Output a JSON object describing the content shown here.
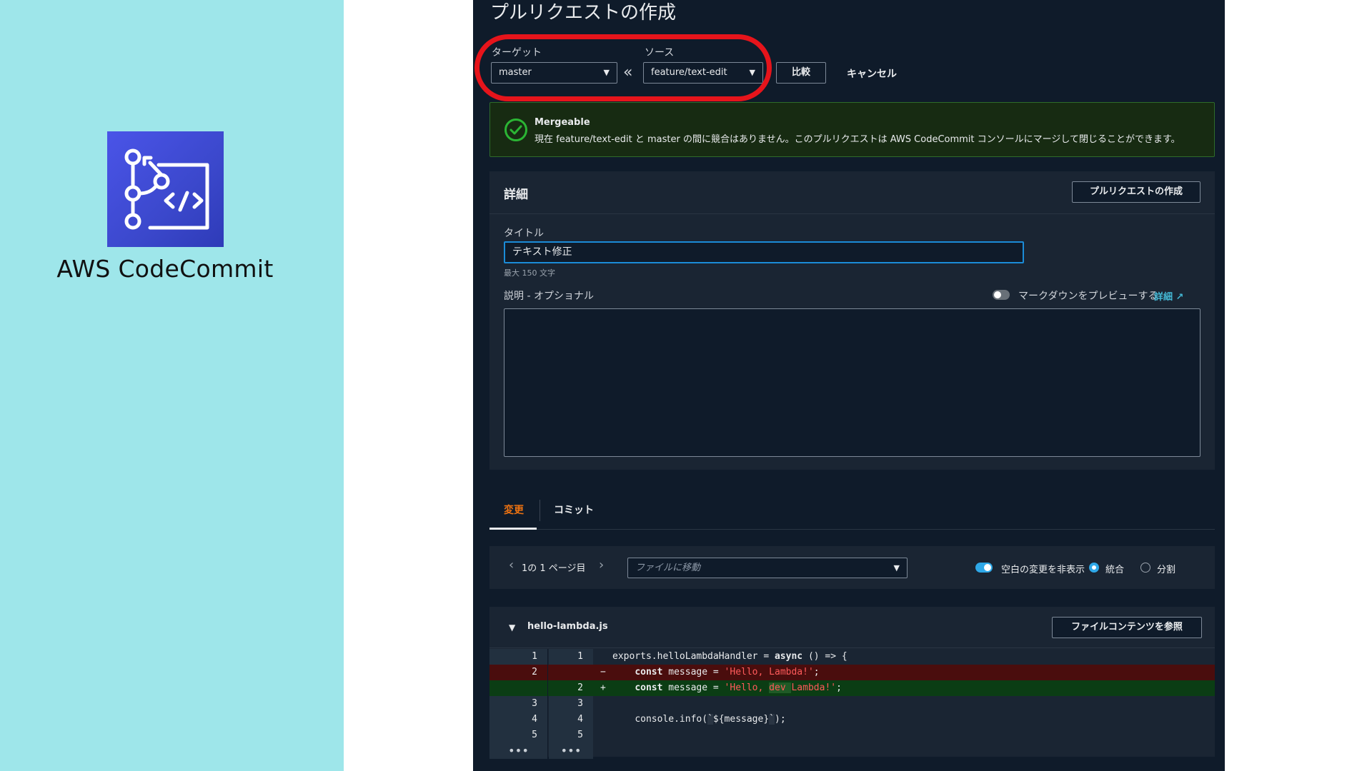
{
  "slide": {
    "product_name": "AWS CodeCommit",
    "background_color": "#9ee6ea",
    "logo_icon": "codecommit-logo-icon"
  },
  "console": {
    "page_title": "プルリクエストの作成",
    "target": {
      "label": "ターゲット",
      "value": "master"
    },
    "source": {
      "label": "ソース",
      "value": "feature/text-edit"
    },
    "compare_button": "比較",
    "cancel_button": "キャンセル",
    "alert": {
      "title": "Mergeable",
      "message": "現在 feature/text-edit と master の間に競合はありません。このプルリクエストは AWS CodeCommit コンソールにマージして閉じることができます。",
      "color": "#2bb534"
    },
    "details": {
      "title": "詳細",
      "create_button": "プルリクエストの作成",
      "title_field_label": "タイトル",
      "title_field_value": "テキスト修正",
      "title_hint": "最大 150 文字",
      "description_label": "説明 - オプショナル",
      "markdown_preview_label": "マークダウンをプレビューする",
      "markdown_preview_on": false,
      "details_link": "詳細"
    },
    "tabs": [
      {
        "label": "変更",
        "active": true
      },
      {
        "label": "コミット",
        "active": false
      }
    ],
    "diff_toolbar": {
      "pager": "1の 1 ページ目",
      "file_select_placeholder": "ファイルに移動",
      "hide_whitespace_label": "空白の変更を非表示",
      "hide_whitespace_on": true,
      "view_modes": [
        {
          "label": "統合",
          "selected": true
        },
        {
          "label": "分割",
          "selected": false
        }
      ]
    },
    "diff_file": {
      "name": "hello-lambda.js",
      "browse_button": "ファイルコンテンツを参照",
      "lines": [
        {
          "old": "1",
          "new": "1",
          "type": "context",
          "sign": "",
          "code": "exports.helloLambdaHandler = async () => {"
        },
        {
          "old": "2",
          "new": "",
          "type": "del",
          "sign": "−",
          "code": "    const message = 'Hello, Lambda!';"
        },
        {
          "old": "",
          "new": "2",
          "type": "add",
          "sign": "+",
          "code": "    const message = 'Hello, dev Lambda!';"
        },
        {
          "old": "3",
          "new": "3",
          "type": "context",
          "sign": "",
          "code": ""
        },
        {
          "old": "4",
          "new": "4",
          "type": "context",
          "sign": "",
          "code": "    console.info(`${message}`);"
        },
        {
          "old": "5",
          "new": "5",
          "type": "context",
          "sign": "",
          "code": ""
        },
        {
          "old": "•••",
          "new": "•••",
          "type": "context",
          "sign": "",
          "code": ""
        }
      ],
      "code_parts": {
        "l1_prefix": "exports.helloLambdaHandler = ",
        "l1_kw": "async",
        "l1_suffix": " () => {",
        "l2_kw": "const",
        "l2_mid": " message = ",
        "l2_str": "'Hello, Lambda!'",
        "l2_end": ";",
        "l3_str_a": "'Hello, ",
        "l3_str_hl": "dev ",
        "l3_str_b": "Lambda!'",
        "l5_a": "console.info(",
        "l5_tmpl_open": "`",
        "l5_mid": "${message}",
        "l5_tmpl_close": "`",
        "l5_end": ");"
      }
    }
  }
}
